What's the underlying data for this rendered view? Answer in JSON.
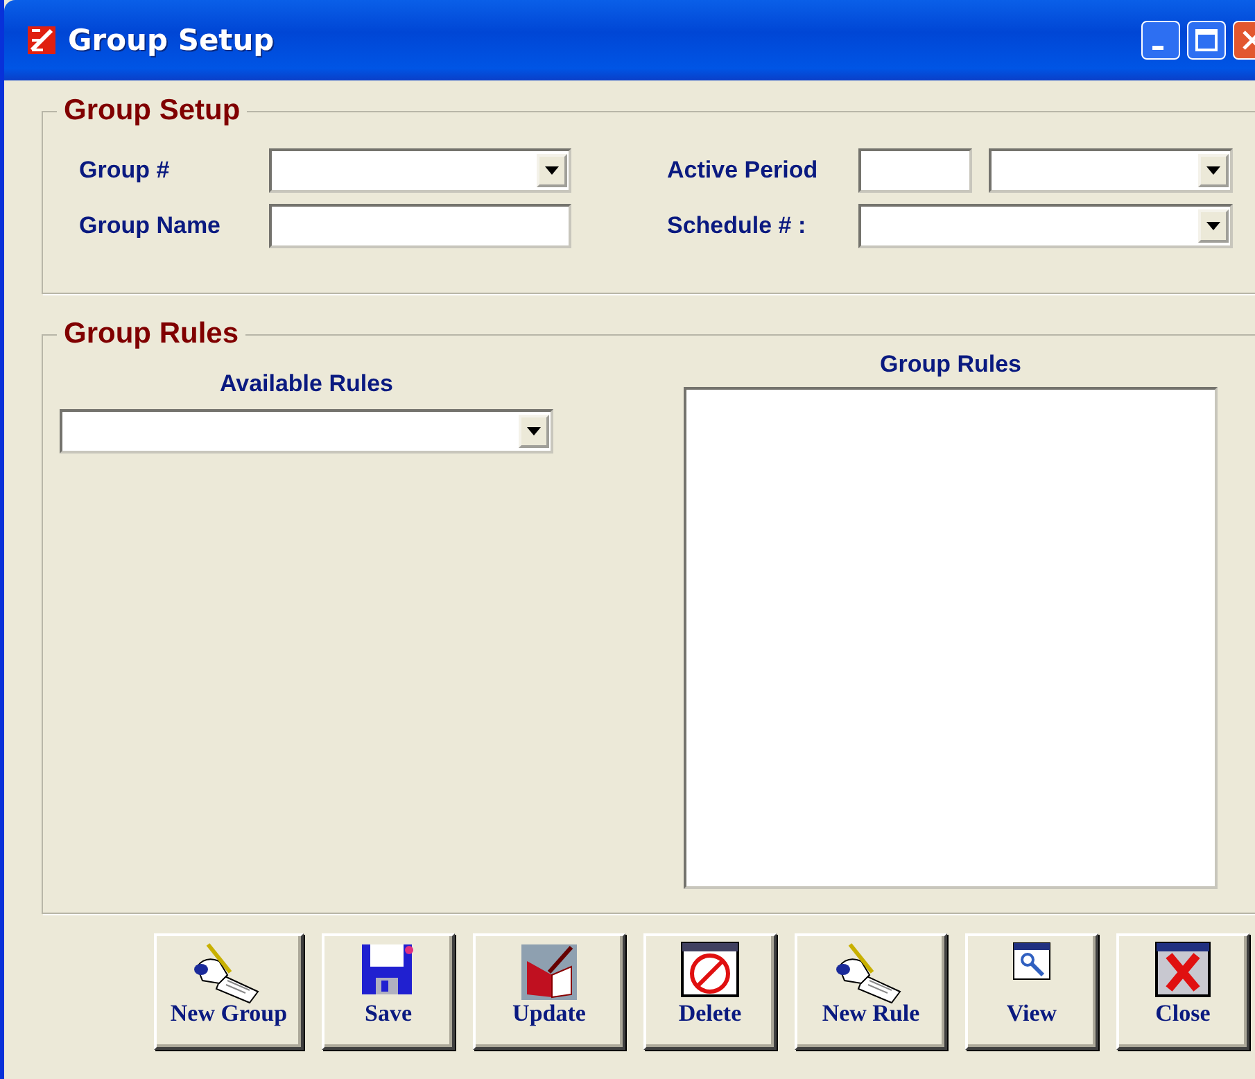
{
  "window": {
    "title": "Group Setup"
  },
  "group_setup": {
    "title": "Group Setup",
    "left": [
      {
        "label": "Group #",
        "kind": "dropdown"
      },
      {
        "label": "Group Name",
        "kind": "text"
      }
    ],
    "right": [
      {
        "label": "Active Period",
        "kind": "text-dropdown"
      },
      {
        "label": "Schedule # :",
        "kind": "dropdown"
      }
    ]
  },
  "group_rules": {
    "title": "Group Rules",
    "available_label": "Available Rules",
    "list_label": "Group Rules"
  },
  "buttons": [
    {
      "label": "New Group",
      "kind": "hand"
    },
    {
      "label": "Save",
      "kind": "floppy"
    },
    {
      "label": "Update",
      "kind": "notebook"
    },
    {
      "label": "Delete",
      "kind": "no-sign"
    },
    {
      "label": "New Rule",
      "kind": "hand"
    },
    {
      "label": "View",
      "kind": "magnifier"
    },
    {
      "label": "Close",
      "kind": "x-mark"
    }
  ]
}
